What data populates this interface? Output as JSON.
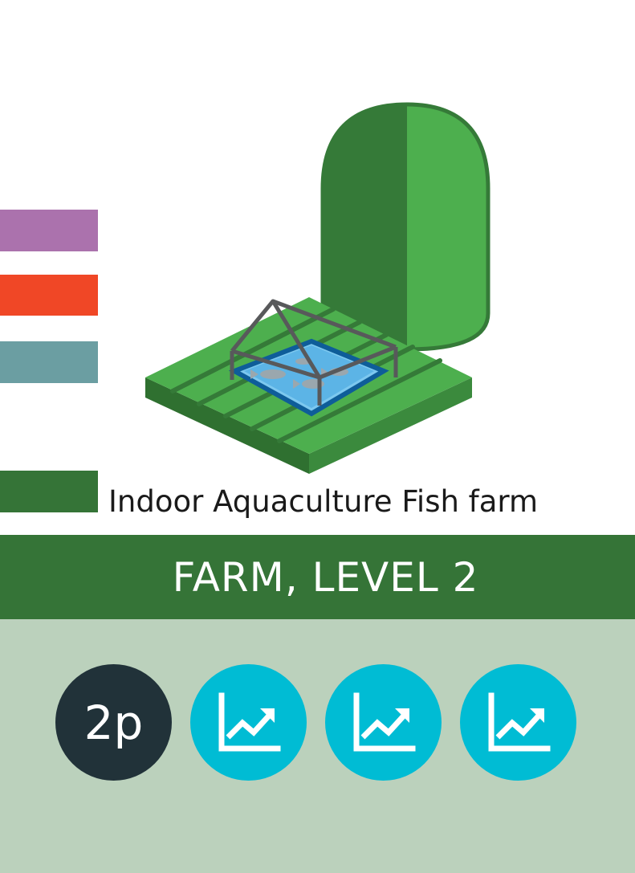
{
  "card": {
    "title": "Indoor Aquaculture Fish farm",
    "level_label": "FARM, LEVEL 2",
    "points_label": "2p",
    "color_bars": [
      {
        "name": "purple",
        "color": "#ab72ad"
      },
      {
        "name": "red",
        "color": "#f04726"
      },
      {
        "name": "teal",
        "color": "#6b9ea2"
      },
      {
        "name": "green",
        "color": "#357437"
      }
    ],
    "illustration": {
      "icon": "fish-farm-icon",
      "subject": "indoor aquaculture fish farm"
    },
    "growth_badges": [
      {
        "icon": "growth-chart-icon"
      },
      {
        "icon": "growth-chart-icon"
      },
      {
        "icon": "growth-chart-icon"
      }
    ]
  },
  "colors": {
    "banner": "#357437",
    "panel": "#bbd1bc",
    "points_badge": "#213239",
    "growth_badge": "#00bcd4",
    "field_light": "#4daf4e",
    "field_dark": "#357a38"
  }
}
